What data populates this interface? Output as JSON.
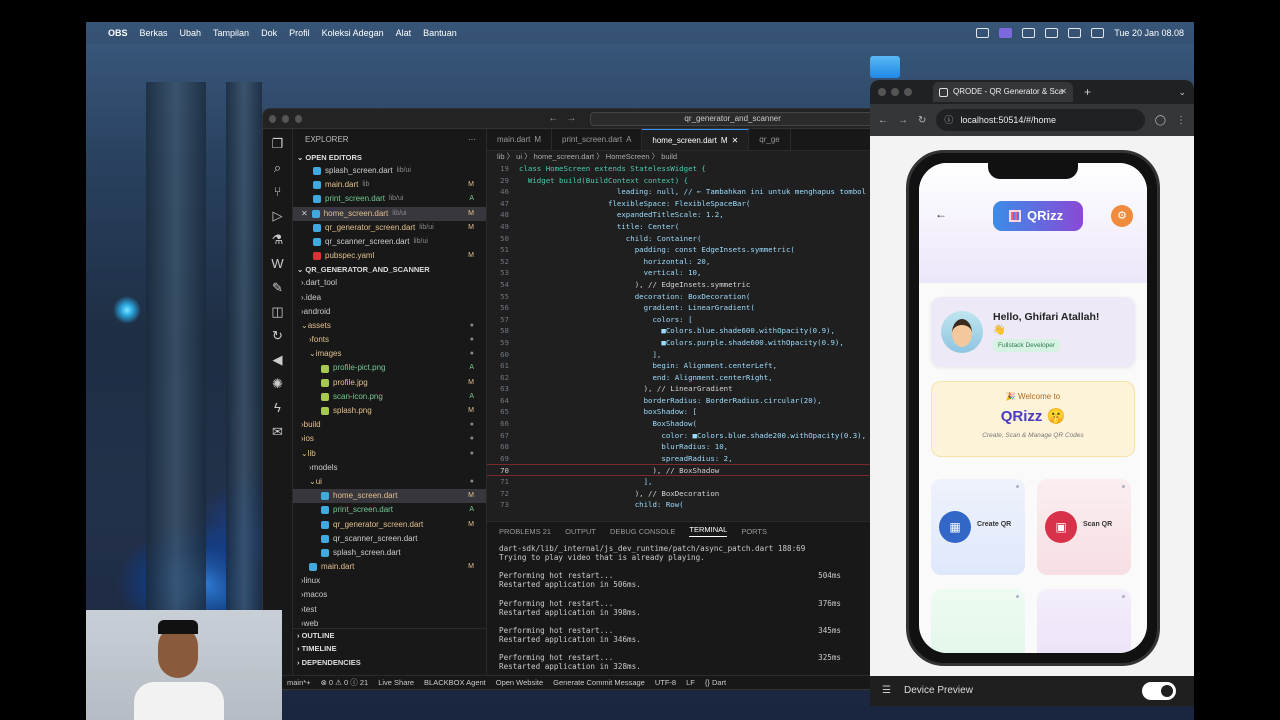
{
  "menubar": {
    "apple": "",
    "app": "OBS",
    "items": [
      "Berkas",
      "Ubah",
      "Tampilan",
      "Dok",
      "Profil",
      "Koleksi Adegan",
      "Alat",
      "Bantuan"
    ],
    "clock": "Tue 20 Jan  08.08"
  },
  "vscode": {
    "search": "qr_generator_and_scanner",
    "explorer_title": "EXPLORER",
    "open_editors": "OPEN EDITORS",
    "open_files": [
      {
        "name": "splash_screen.dart",
        "path": "lib/ui",
        "status": ""
      },
      {
        "name": "main.dart",
        "path": "lib",
        "status": "M"
      },
      {
        "name": "print_screen.dart",
        "path": "lib/ui",
        "status": "A"
      },
      {
        "name": "home_screen.dart",
        "path": "lib/ui",
        "status": "M"
      },
      {
        "name": "qr_generator_screen.dart",
        "path": "lib/ui",
        "status": "M"
      },
      {
        "name": "qr_scanner_screen.dart",
        "path": "lib/ui",
        "status": ""
      },
      {
        "name": "pubspec.yaml",
        "path": "",
        "status": "M"
      }
    ],
    "project": "QR_GENERATOR_AND_SCANNER",
    "tree": [
      {
        "label": ".dart_tool",
        "status": ""
      },
      {
        "label": ".idea",
        "status": ""
      },
      {
        "label": "android",
        "status": ""
      },
      {
        "label": "assets",
        "status": "●"
      },
      {
        "label": "fonts",
        "status": "●"
      },
      {
        "label": "images",
        "status": "●"
      },
      {
        "label": "profile-pict.png",
        "status": "A"
      },
      {
        "label": "profile.jpg",
        "status": "M"
      },
      {
        "label": "scan-icon.png",
        "status": "A"
      },
      {
        "label": "splash.png",
        "status": "M"
      },
      {
        "label": "build",
        "status": "●"
      },
      {
        "label": "ios",
        "status": "●"
      },
      {
        "label": "lib",
        "status": "●"
      },
      {
        "label": "models",
        "status": ""
      },
      {
        "label": "ui",
        "status": "●"
      },
      {
        "label": "home_screen.dart",
        "status": "M"
      },
      {
        "label": "print_screen.dart",
        "status": "A"
      },
      {
        "label": "qr_generator_screen.dart",
        "status": "M"
      },
      {
        "label": "qr_scanner_screen.dart",
        "status": ""
      },
      {
        "label": "splash_screen.dart",
        "status": ""
      },
      {
        "label": "main.dart",
        "status": "M"
      },
      {
        "label": "linux",
        "status": ""
      },
      {
        "label": "macos",
        "status": ""
      },
      {
        "label": "test",
        "status": ""
      },
      {
        "label": "web",
        "status": ""
      }
    ],
    "outline": "OUTLINE",
    "timeline": "TIMELINE",
    "dependencies": "DEPENDENCIES",
    "tabs": [
      {
        "label": "main.dart",
        "status": "M"
      },
      {
        "label": "print_screen.dart",
        "status": "A"
      },
      {
        "label": "home_screen.dart",
        "status": "M"
      },
      {
        "label": "qr_ge",
        "status": ""
      }
    ],
    "breadcrumb": "lib 〉 ui 〉 home_screen.dart 〉 HomeScreen 〉 build",
    "code": [
      {
        "n": "19",
        "t": "class HomeScreen extends StatelessWidget {"
      },
      {
        "n": "29",
        "t": "  Widget build(BuildContext context) {"
      },
      {
        "n": "46",
        "t": "                      leading: null, // ← Tambahkan ini untuk menghapus tombol ba"
      },
      {
        "n": "47",
        "t": "                    flexibleSpace: FlexibleSpaceBar("
      },
      {
        "n": "48",
        "t": "                      expandedTitleScale: 1.2,"
      },
      {
        "n": "49",
        "t": "                      title: Center("
      },
      {
        "n": "50",
        "t": "                        child: Container("
      },
      {
        "n": "51",
        "t": "                          padding: const EdgeInsets.symmetric("
      },
      {
        "n": "52",
        "t": "                            horizontal: 20,"
      },
      {
        "n": "53",
        "t": "                            vertical: 10,"
      },
      {
        "n": "54",
        "t": "                          ), // EdgeInsets.symmetric"
      },
      {
        "n": "55",
        "t": "                          decoration: BoxDecoration("
      },
      {
        "n": "56",
        "t": "                            gradient: LinearGradient("
      },
      {
        "n": "57",
        "t": "                              colors: ["
      },
      {
        "n": "58",
        "t": "                                ■Colors.blue.shade600.withOpacity(0.9),"
      },
      {
        "n": "59",
        "t": "                                ■Colors.purple.shade600.withOpacity(0.9),"
      },
      {
        "n": "60",
        "t": "                              ],"
      },
      {
        "n": "61",
        "t": "                              begin: Alignment.centerLeft,"
      },
      {
        "n": "62",
        "t": "                              end: Alignment.centerRight,"
      },
      {
        "n": "63",
        "t": "                            ), // LinearGradient"
      },
      {
        "n": "64",
        "t": "                            borderRadius: BorderRadius.circular(20),"
      },
      {
        "n": "65",
        "t": "                            boxShadow: ["
      },
      {
        "n": "66",
        "t": "                              BoxShadow("
      },
      {
        "n": "67",
        "t": "                                color: ■Colors.blue.shade200.withOpacity(0.3),"
      },
      {
        "n": "68",
        "t": "                                blurRadius: 10,"
      },
      {
        "n": "69",
        "t": "                                spreadRadius: 2,"
      },
      {
        "n": "70",
        "t": "                              ), // BoxShadow"
      },
      {
        "n": "71",
        "t": "                            ],"
      },
      {
        "n": "72",
        "t": "                          ), // BoxDecoration"
      },
      {
        "n": "73",
        "t": "                          child: Row("
      }
    ],
    "panel_tabs": [
      "PROBLEMS  21",
      "OUTPUT",
      "DEBUG CONSOLE",
      "TERMINAL",
      "PORTS"
    ],
    "terminal": [
      {
        "t": "dart-sdk/lib/_internal/js_dev_runtime/patch/async_patch.dart 188:69",
        "ms": ""
      },
      {
        "t": "Trying to play video that is already playing.",
        "ms": ""
      },
      {
        "t": "",
        "ms": ""
      },
      {
        "t": "Performing hot restart...",
        "ms": "504ms"
      },
      {
        "t": "Restarted application in 506ms.",
        "ms": ""
      },
      {
        "t": "",
        "ms": ""
      },
      {
        "t": "Performing hot restart...",
        "ms": "376ms"
      },
      {
        "t": "Restarted application in 398ms.",
        "ms": ""
      },
      {
        "t": "",
        "ms": ""
      },
      {
        "t": "Performing hot restart...",
        "ms": "345ms"
      },
      {
        "t": "Restarted application in 346ms.",
        "ms": ""
      },
      {
        "t": "",
        "ms": ""
      },
      {
        "t": "Performing hot restart...",
        "ms": "325ms"
      },
      {
        "t": "Restarted application in 328ms.",
        "ms": ""
      }
    ],
    "status": [
      "main*+",
      "⊗ 0 ⚠ 0 ⓘ 21",
      "Live Share",
      "BLACKBOX Agent",
      "Open Website",
      "Generate Commit Message",
      "UTF-8",
      "LF",
      "{} Dart"
    ]
  },
  "chrome": {
    "tab_title": "QRODE - QR Generator & Sca",
    "url": "localhost:50514/#/home",
    "device_preview": "Device Preview"
  },
  "app": {
    "logo": "QRizz",
    "hello": "Hello, Ghifari Atallah!",
    "wave": "👋",
    "role": "Fullstack Developer",
    "welcome_label": "🎉 Welcome to",
    "welcome_title": "QRizz 🤫",
    "welcome_sub": "Create, Scan & Manage QR Codes",
    "create": "Create QR",
    "scan": "Scan QR"
  },
  "colors": {
    "accent_blue": "#3b8de8",
    "accent_purple": "#8a49d6",
    "create_icon": "#3267c8",
    "scan_icon": "#d8324a"
  }
}
